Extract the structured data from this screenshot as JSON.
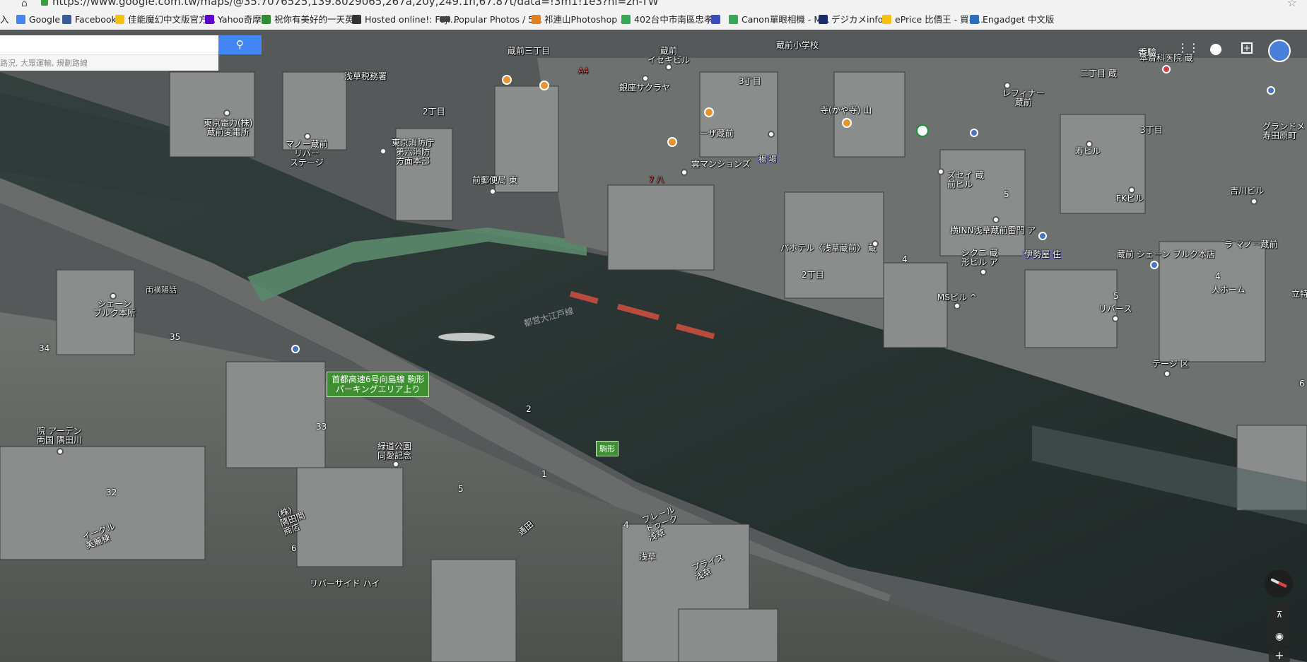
{
  "browser": {
    "url": "https://www.google.com.tw/maps/@35.7076525,139.8029065,267a,20y,249.1h,67.87t/data=!3m1!1e3?hl=zh-TW",
    "bookmarks": [
      {
        "label": "入",
        "color": "#ffffff"
      },
      {
        "label": "Google",
        "color": "#4285f4"
      },
      {
        "label": "Facebook",
        "color": "#3b5998"
      },
      {
        "label": "佳能魔幻中文版官方...",
        "color": "#f4c20d"
      },
      {
        "label": "Yahoo奇摩",
        "color": "#5f01d1"
      },
      {
        "label": "祝你有美好的一天英...",
        "color": "#2e8b2e"
      },
      {
        "label": "Hosted online!: Fuji...",
        "color": "#333333"
      },
      {
        "label": "Popular Photos / 5...",
        "color": "#444444"
      },
      {
        "label": "祁連山Photoshop ...",
        "color": "#e08020"
      },
      {
        "label": "402台中市南區忠孝...",
        "color": "#34a853"
      },
      {
        "label": "",
        "color": "#3b4cc0"
      },
      {
        "label": "Canon單眼相機 - M...",
        "color": "#34a853"
      },
      {
        "label": "デジカメinfo",
        "color": "#1a2a6a"
      },
      {
        "label": "ePrice 比價王 - 買手...",
        "color": "#f4c20d"
      },
      {
        "label": "Engadget 中文版",
        "color": "#2a6fbf"
      }
    ]
  },
  "search": {
    "placeholder": "",
    "hint": "路況, 大眾運輸, 規劃路線",
    "button_icon": "search-icon"
  },
  "topright": {
    "label": "香驗"
  },
  "map": {
    "labels": [
      {
        "text": "蔵前三丁目"
      },
      {
        "text": "蔵前小学校"
      },
      {
        "text": "浅草税務署"
      },
      {
        "text": "蔵前\nイセキビル"
      },
      {
        "text": "銀座サクラヤ"
      },
      {
        "text": "3丁目"
      },
      {
        "text": "2丁目"
      },
      {
        "text": "東京電力(株)\n蔵前変電所"
      },
      {
        "text": "マノー蔵前\nリバー\nステージ"
      },
      {
        "text": "東京消防庁\n第六消防\n方面本部"
      },
      {
        "text": "前郵便局 東"
      },
      {
        "text": "雲マンションズ"
      },
      {
        "text": "ーザ蔵前"
      },
      {
        "text": "寺(かや寺) 山"
      },
      {
        "text": "レフィナー\n蔵前"
      },
      {
        "text": "二丁目 蔵"
      },
      {
        "text": "本齋科医院 蔵"
      },
      {
        "text": "3丁目"
      },
      {
        "text": "寿ビル"
      },
      {
        "text": "グランドメ\n寿田原町"
      },
      {
        "text": "吉川ビル"
      },
      {
        "text": "FKビル"
      },
      {
        "text": "ズセイ 蔵\n前ビル"
      },
      {
        "text": "横INN浅草蔵前雷門 ア"
      },
      {
        "text": "パホテル〈浅草蔵前〉 蔵"
      },
      {
        "text": "シクニ 蔵\n形ビル ア"
      },
      {
        "text": "伊勢屋 住"
      },
      {
        "text": "蔵前 シェーン ブルク本店"
      },
      {
        "text": "ラ マノー蔵前"
      },
      {
        "text": "2丁目"
      },
      {
        "text": "MSビル ^"
      },
      {
        "text": "リバース"
      },
      {
        "text": "人ホーム"
      },
      {
        "text": "立特"
      },
      {
        "text": "テージ 区"
      },
      {
        "text": "シェーン\nブルク本所"
      },
      {
        "text": "両横陽話"
      },
      {
        "text": "院 アーデン\n両国 隅田川"
      },
      {
        "text": "緑道公園\n同愛記念"
      },
      {
        "text": "リバーサイド ハイ"
      },
      {
        "text": "イーグル\n美麗棟"
      },
      {
        "text": "(株)\n隅田間\n商店"
      },
      {
        "text": "フレール\nドゥーク\n浅草"
      },
      {
        "text": "プライス\n浅草"
      },
      {
        "text": "浅草"
      },
      {
        "text": "通田"
      },
      {
        "text": "都営大江戸線"
      },
      {
        "text": "A4"
      },
      {
        "text": "7 八"
      },
      {
        "text": "楊 場"
      }
    ],
    "numbers": [
      "35",
      "34",
      "33",
      "32",
      "6",
      "5",
      "2",
      "4",
      "5",
      "4",
      "6",
      "5",
      "1",
      "4"
    ],
    "highway_label": "首都高速6号向島線 駒形\nパーキングエリア上り",
    "exit_label": "駒形"
  },
  "controls": {
    "compass": "compass-icon",
    "tilt": "tilt-icon",
    "locate": "locate-icon",
    "zoom_in": "+"
  },
  "colors": {
    "water": "#27332f",
    "search_button": "#4285f4",
    "highway_sign": "#3d8f2f"
  }
}
